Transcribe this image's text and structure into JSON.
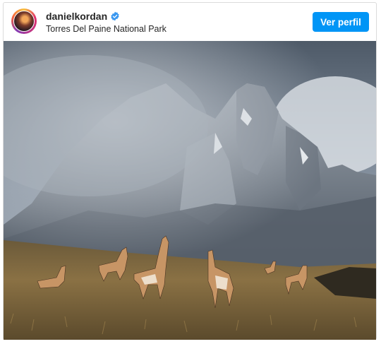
{
  "post": {
    "username": "danielkordan",
    "location": "Torres Del Paine National Park",
    "follow_label": "Ver perfil"
  },
  "icons": {
    "verified": "verified-badge-icon"
  },
  "colors": {
    "accent": "#0095f6",
    "verified": "#3897f0",
    "border": "#dbdbdb"
  }
}
